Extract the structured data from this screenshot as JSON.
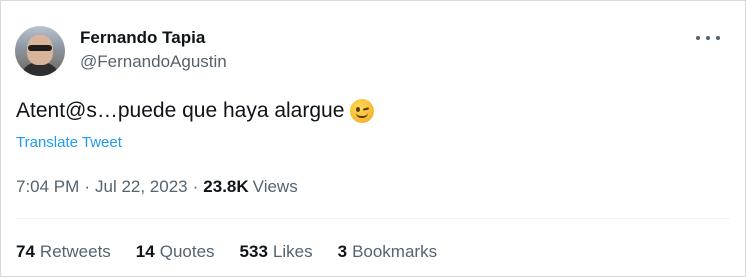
{
  "author": {
    "name": "Fernando Tapia",
    "handle": "@FernandoAgustin"
  },
  "tweet": {
    "text": "Atent@s…puede que haya alargue",
    "emoji": "winking-face-emoji",
    "translate_label": "Translate Tweet"
  },
  "meta": {
    "time": "7:04 PM",
    "separator": "·",
    "date": "Jul 22, 2023",
    "views_count": "23.8K",
    "views_label": "Views"
  },
  "stats": {
    "retweets_count": "74",
    "retweets_label": "Retweets",
    "quotes_count": "14",
    "quotes_label": "Quotes",
    "likes_count": "533",
    "likes_label": "Likes",
    "bookmarks_count": "3",
    "bookmarks_label": "Bookmarks"
  },
  "colors": {
    "link": "#1d9bf0",
    "secondary_text": "#536471",
    "primary_text": "#0f1419"
  }
}
